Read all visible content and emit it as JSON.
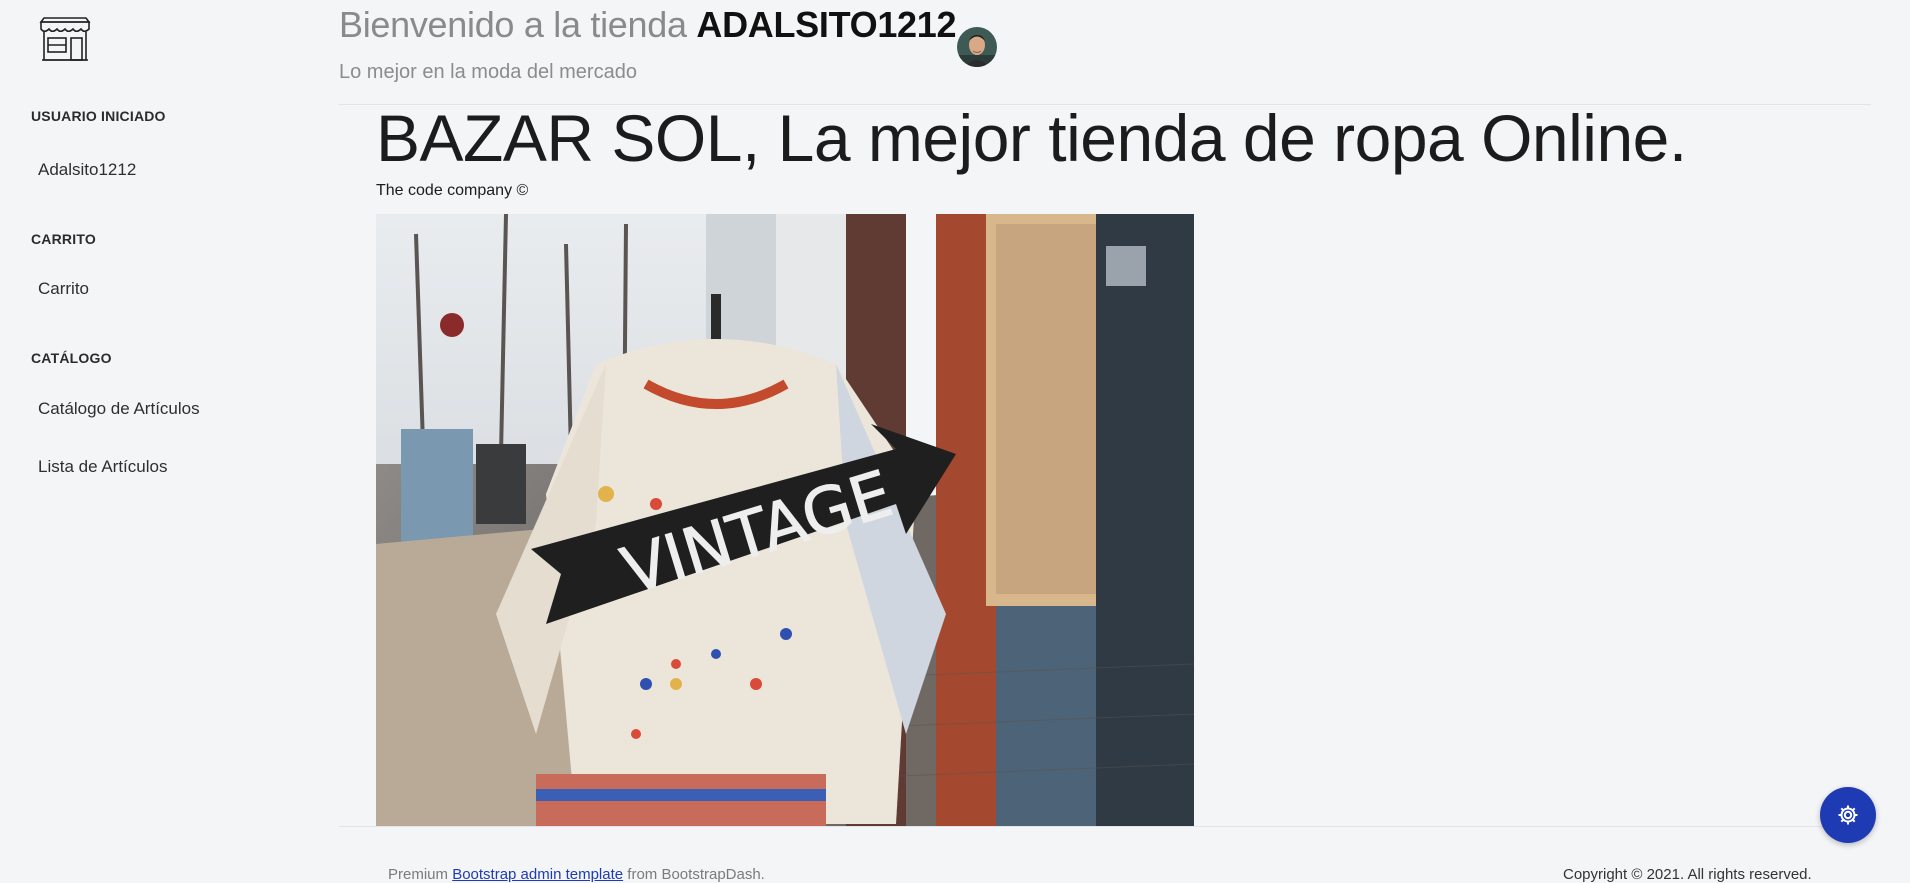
{
  "sidebar": {
    "logo_icon": "store-icon",
    "sections": [
      {
        "title": "USUARIO INICIADO",
        "items": [
          "Adalsito1212"
        ]
      },
      {
        "title": "CARRITO",
        "items": [
          "Carrito"
        ]
      },
      {
        "title": "CATÁLOGO",
        "items": [
          "Catálogo de Artículos",
          "Lista de Artículos"
        ]
      }
    ]
  },
  "header": {
    "welcome_prefix": "Bienvenido a la tienda ",
    "username": "ADALSITO1212",
    "subtitle": "Lo mejor en la moda del mercado",
    "avatar_icon": "user-avatar"
  },
  "main": {
    "title": "BAZAR SOL, La mejor tienda de ropa Online.",
    "company": "The code company ©",
    "image_sign_text": "VINTAGE"
  },
  "footer": {
    "premium": "Premium ",
    "link_text": "Bootstrap admin template",
    "from": " from BootstrapDash.",
    "copyright": "Copyright © 2021. All rights reserved."
  },
  "settings": {
    "icon": "gear-icon"
  },
  "colors": {
    "accent": "#1f3bb3",
    "background": "#f4f5f7"
  }
}
